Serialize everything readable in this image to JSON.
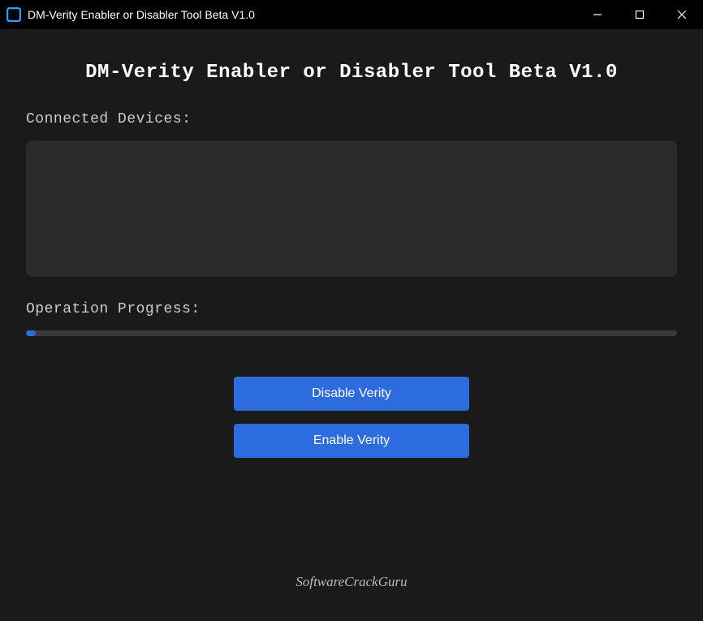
{
  "window": {
    "title": "DM-Verity Enabler or Disabler Tool Beta V1.0"
  },
  "header": {
    "title": "DM-Verity Enabler or Disabler Tool Beta V1.0"
  },
  "sections": {
    "devices_label": "Connected Devices:",
    "progress_label": "Operation Progress:"
  },
  "progress": {
    "percent": 1.5
  },
  "buttons": {
    "disable_label": "Disable Verity",
    "enable_label": "Enable Verity"
  },
  "footer": {
    "branding": "SoftwareCrackGuru"
  },
  "colors": {
    "accent": "#2d6cdf",
    "background": "#1a1a1a",
    "panel": "#2b2b2b",
    "titlebar": "#000000"
  }
}
